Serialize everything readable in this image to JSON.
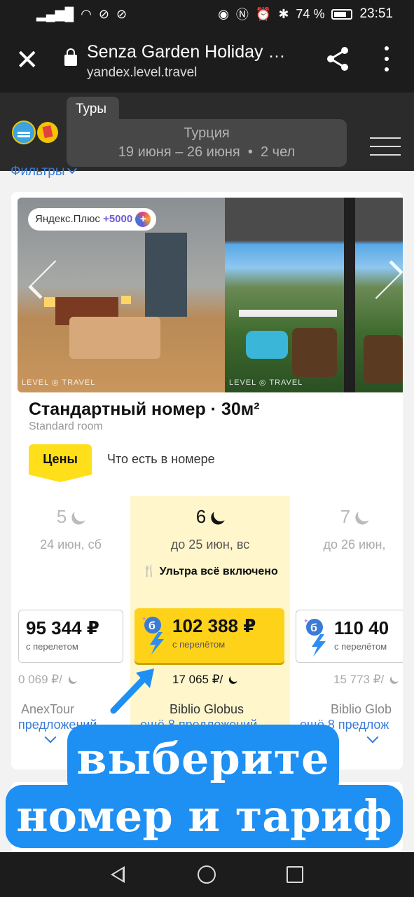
{
  "status_bar": {
    "battery": "74 %",
    "time": "23:51"
  },
  "browser": {
    "title": "Senza Garden Holiday …",
    "url": "yandex.level.travel"
  },
  "header": {
    "tab_label": "Туры",
    "country": "Турция",
    "dates": "19 июня – 26 июня",
    "separator": "•",
    "guests": "2 чел"
  },
  "filters_label": "Фильтры",
  "room": {
    "plus_badge_text": "Яндекс.Плюс",
    "plus_badge_value": "+5000",
    "watermark": "LEVEL ◎ TRAVEL",
    "title": "Стандартный номер · 30м²",
    "subtitle": "Standard room",
    "tab_prices": "Цены",
    "tab_whats_in_room": "Что есть в номере"
  },
  "offers": [
    {
      "nights": "5",
      "until": "24 июн, сб",
      "price": "95 344 ₽",
      "note": "с перелетом",
      "per_day": "0 069 ₽/",
      "operator": "AnexTour",
      "more": "предложений"
    },
    {
      "nights": "6",
      "until": "до 25 июн, вс",
      "meal": "Ультра всё включено",
      "price": "102 388 ₽",
      "note": "с перелётом",
      "per_day": "17 065 ₽/",
      "operator": "Biblio Globus",
      "more": "ещё 8 предложений"
    },
    {
      "nights": "7",
      "until": "до 26 июн,",
      "price": "110 40",
      "note": "с перелётом",
      "per_day": "15 773 ₽/",
      "operator": "Biblio Glob",
      "more": "ещё 8 предлож"
    }
  ],
  "overlay": {
    "line1": "выберите",
    "line2": "номер и тариф"
  },
  "colors": {
    "accent_yellow": "#ffd21a",
    "overlay_blue": "#1e8ff3",
    "link_blue": "#3a7bd5"
  }
}
